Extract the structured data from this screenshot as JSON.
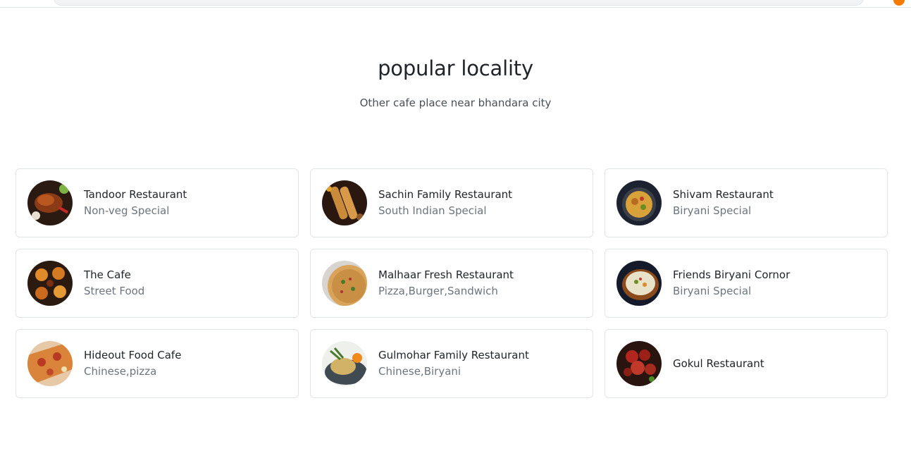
{
  "section": {
    "title": "popular locality",
    "subtitle": "Other cafe place near bhandara city"
  },
  "restaurants": [
    {
      "name": "Tandoor Restaurant",
      "desc": "Non-veg Special",
      "image": "tandoori-chicken-photo"
    },
    {
      "name": "Sachin Family Restaurant",
      "desc": "South Indian Special",
      "image": "dosa-photo"
    },
    {
      "name": "Shivam Restaurant",
      "desc": "Biryani Special",
      "image": "biryani-photo"
    },
    {
      "name": "The Cafe",
      "desc": "Street Food",
      "image": "street-food-photo"
    },
    {
      "name": "Malhaar Fresh Restaurant",
      "desc": "Pizza,Burger,Sandwich",
      "image": "pizza-photo"
    },
    {
      "name": "Friends Biryani Cornor",
      "desc": "Biryani Special",
      "image": "biryani-bowl-photo"
    },
    {
      "name": "Hideout Food Cafe",
      "desc": "Chinese,pizza",
      "image": "pizza-slice-photo"
    },
    {
      "name": "Gulmohar Family Restaurant",
      "desc": "Chinese,Biryani",
      "image": "noodles-photo"
    },
    {
      "name": "Gokul Restaurant",
      "desc": "",
      "image": "chilli-chicken-photo"
    }
  ],
  "colors": {
    "border": "#e1e4e8",
    "muted_text": "#6c757d",
    "heading_text": "#212529"
  }
}
